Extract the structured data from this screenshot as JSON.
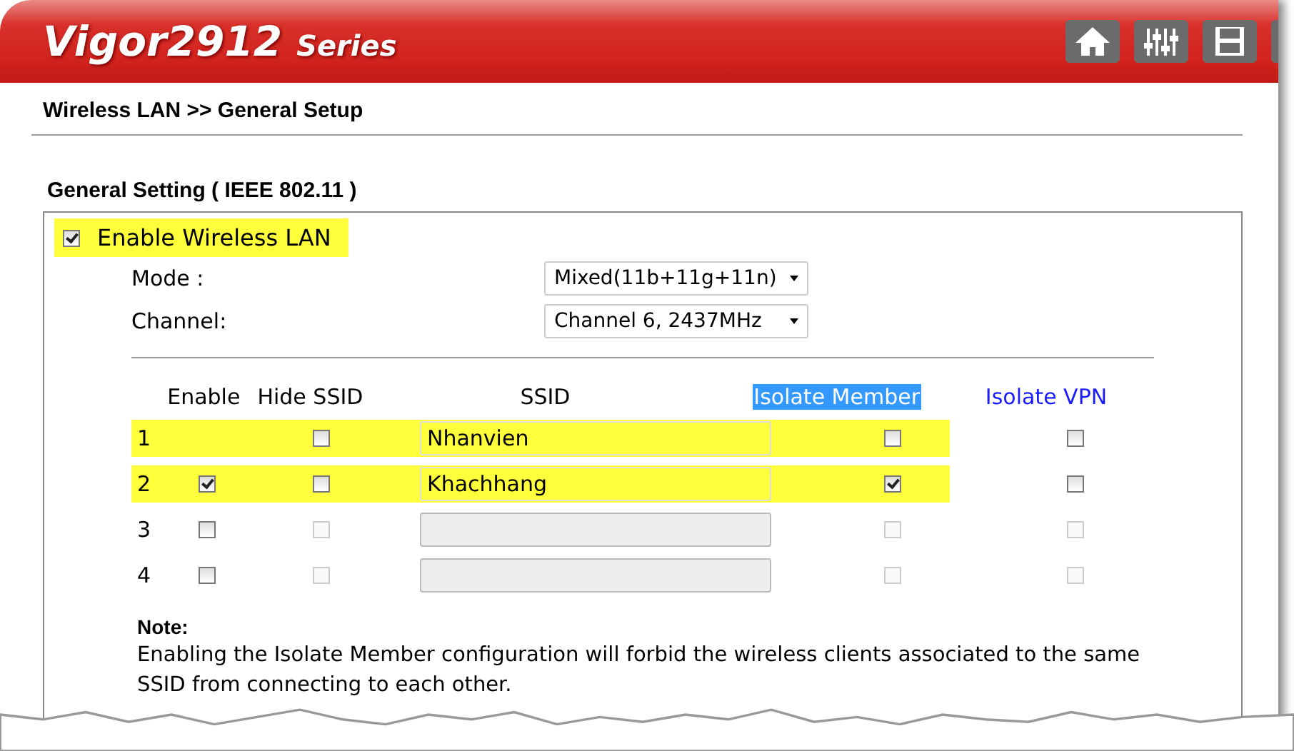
{
  "header": {
    "product": "Vigor2912",
    "series": "Series"
  },
  "breadcrumb": "Wireless LAN >> General Setup",
  "section_title": "General Setting ( IEEE 802.11 )",
  "enable_wireless": {
    "label": "Enable Wireless LAN",
    "checked": true,
    "highlighted": true
  },
  "fields": [
    {
      "label": "Mode :",
      "value": "Mixed(11b+11g+11n)"
    },
    {
      "label": "Channel:",
      "value": "Channel 6, 2437MHz"
    }
  ],
  "columns": [
    {
      "label": "Enable",
      "highlighted": false
    },
    {
      "label": "Hide SSID",
      "highlighted": false
    },
    {
      "label": "SSID",
      "highlighted": false
    },
    {
      "label": "Isolate Member",
      "highlighted": true
    },
    {
      "label": "Isolate VPN",
      "highlighted": false
    }
  ],
  "rows": [
    {
      "number": "1",
      "highlighted": true,
      "hide_ssid": {
        "checked": false,
        "disabled": false
      },
      "ssid": {
        "value": "Nhanvien",
        "disabled": false
      },
      "isolate_member": {
        "checked": false,
        "disabled": false
      },
      "isolate_vpn": {
        "checked": false,
        "disabled": false
      }
    },
    {
      "number": "2",
      "highlighted": true,
      "enable": {
        "checked": true,
        "disabled": false
      },
      "hide_ssid": {
        "checked": false,
        "disabled": false
      },
      "ssid": {
        "value": "Khachhang",
        "disabled": false
      },
      "isolate_member": {
        "checked": true,
        "disabled": false
      },
      "isolate_vpn": {
        "checked": false,
        "disabled": false
      }
    },
    {
      "number": "3",
      "highlighted": false,
      "enable": {
        "checked": false,
        "disabled": false
      },
      "hide_ssid": {
        "checked": false,
        "disabled": true
      },
      "ssid": {
        "disabled": true
      },
      "isolate_member": {
        "checked": false,
        "disabled": true
      },
      "isolate_vpn": {
        "checked": false,
        "disabled": true
      }
    },
    {
      "number": "4",
      "highlighted": false,
      "enable": {
        "checked": false,
        "disabled": false
      },
      "hide_ssid": {
        "checked": false,
        "disabled": true
      },
      "ssid": {
        "disabled": true
      },
      "isolate_member": {
        "checked": false,
        "disabled": true
      },
      "isolate_vpn": {
        "checked": false,
        "disabled": true
      }
    }
  ],
  "note": {
    "title": "Note:",
    "text": "Enabling the Isolate Member configuration will forbid the wireless clients associated to the same SSID from connecting to each other."
  }
}
